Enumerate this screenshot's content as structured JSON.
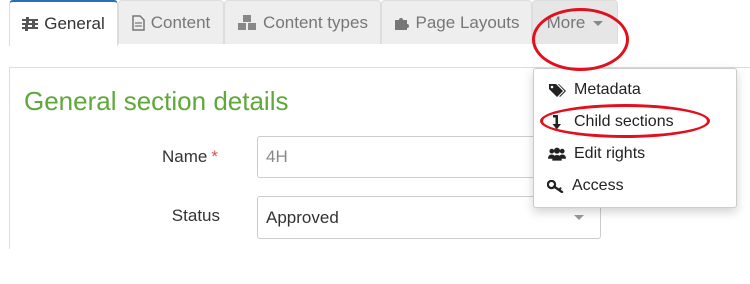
{
  "tabs": [
    {
      "label": "General",
      "icon": "sliders-icon",
      "active": true
    },
    {
      "label": "Content",
      "icon": "document-icon",
      "active": false
    },
    {
      "label": "Content types",
      "icon": "cubes-icon",
      "active": false
    },
    {
      "label": "Page Layouts",
      "icon": "puzzle-icon",
      "active": false
    },
    {
      "label": "More",
      "icon": "caret-down-icon",
      "active": false
    }
  ],
  "section": {
    "title": "General section details"
  },
  "form": {
    "name_label": "Name",
    "required_marker": "*",
    "name_value": "4H",
    "status_label": "Status",
    "status_value": "Approved"
  },
  "more_menu": {
    "items": [
      {
        "label": "Metadata",
        "icon": "tags-icon"
      },
      {
        "label": "Child sections",
        "icon": "level-down-icon"
      },
      {
        "label": "Edit rights",
        "icon": "users-icon"
      },
      {
        "label": "Access",
        "icon": "key-icon"
      }
    ]
  },
  "colors": {
    "accent": "#2a6ebb",
    "title_green": "#5fa83a",
    "required_red": "#d9534f",
    "annotation_red": "#e0101e"
  }
}
